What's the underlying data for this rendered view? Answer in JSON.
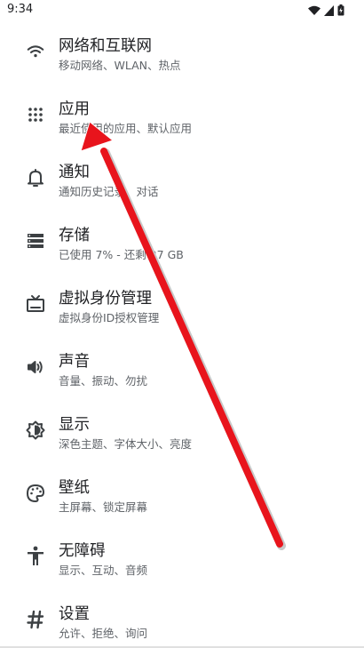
{
  "status_bar": {
    "time": "9:34",
    "icons": [
      "wifi-icon",
      "signal-icon",
      "battery-icon"
    ]
  },
  "settings": {
    "items": [
      {
        "icon": "wifi-icon",
        "title": "网络和互联网",
        "subtitle": "移动网络、WLAN、热点"
      },
      {
        "icon": "apps-grid-icon",
        "title": "应用",
        "subtitle": "最近使用的应用、默认应用"
      },
      {
        "icon": "bell-icon",
        "title": "通知",
        "subtitle": "通知历史记录、对话"
      },
      {
        "icon": "storage-icon",
        "title": "存储",
        "subtitle": "已使用 7% - 还剩 27 GB"
      },
      {
        "icon": "tv-icon",
        "title": "虚拟身份管理",
        "subtitle": "虚拟身份ID授权管理"
      },
      {
        "icon": "speaker-icon",
        "title": "声音",
        "subtitle": "音量、振动、勿扰"
      },
      {
        "icon": "brightness-icon",
        "title": "显示",
        "subtitle": "深色主题、字体大小、亮度"
      },
      {
        "icon": "palette-icon",
        "title": "壁纸",
        "subtitle": "主屏幕、锁定屏幕"
      },
      {
        "icon": "accessibility-icon",
        "title": "无障碍",
        "subtitle": "显示、互动、音频"
      },
      {
        "icon": "hash-icon",
        "title": "设置",
        "subtitle": "允许、拒绝、询问"
      }
    ]
  },
  "colors": {
    "annotation_arrow": "#e8141c",
    "icon": "#3c4043"
  }
}
